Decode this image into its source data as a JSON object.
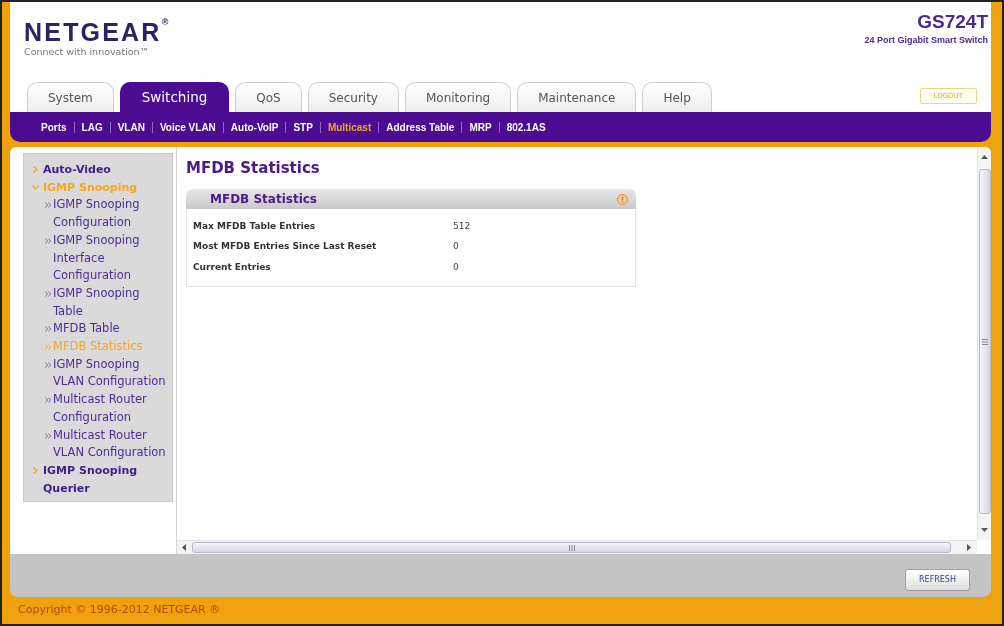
{
  "header": {
    "logo": "NETGEAR$^{®}$",
    "tagline": "Connect with innovation™",
    "model": "GS724T",
    "model_description": "24 Port Gigabit Smart Switch"
  },
  "tabs": [
    {
      "label": "System",
      "selected": false
    },
    {
      "label": "Switching",
      "selected": true
    },
    {
      "label": "QoS",
      "selected": false
    },
    {
      "label": "Security",
      "selected": false
    },
    {
      "label": "Monitoring",
      "selected": false
    },
    {
      "label": "Maintenance",
      "selected": false
    },
    {
      "label": "Help",
      "selected": false
    }
  ],
  "logout_button": "LOGOUT",
  "subnav": [
    {
      "label": "Ports",
      "selected": false
    },
    {
      "label": "LAG",
      "selected": false
    },
    {
      "label": "VLAN",
      "selected": false
    },
    {
      "label": "Voice VLAN",
      "selected": false
    },
    {
      "label": "Auto-VoIP",
      "selected": false
    },
    {
      "label": "STP",
      "selected": false
    },
    {
      "label": "Multicast",
      "selected": true
    },
    {
      "label": "Address Table",
      "selected": false
    },
    {
      "label": "MRP",
      "selected": false
    },
    {
      "label": "802.1AS",
      "selected": false
    }
  ],
  "sidebar": {
    "items": [
      {
        "label": "Auto-Video",
        "selected": false,
        "expanded": false
      },
      {
        "label": "IGMP Snooping",
        "selected": true,
        "expanded": true,
        "children": [
          {
            "label": "IGMP Snooping Configuration",
            "selected": false
          },
          {
            "label": "IGMP Snooping Interface Configuration",
            "selected": false
          },
          {
            "label": "IGMP Snooping Table",
            "selected": false
          },
          {
            "label": "MFDB Table",
            "selected": false
          },
          {
            "label": "MFDB Statistics",
            "selected": true
          },
          {
            "label": "IGMP Snooping VLAN Configuration",
            "selected": false
          },
          {
            "label": "Multicast Router Configuration",
            "selected": false
          },
          {
            "label": "Multicast Router VLAN Configuration",
            "selected": false
          }
        ]
      },
      {
        "label": "IGMP Snooping Querier",
        "selected": false,
        "expanded": false
      }
    ]
  },
  "page_title": "MFDB Statistics",
  "panel": {
    "title": "MFDB Statistics",
    "rows": [
      {
        "label": "Max MFDB Table Entries",
        "value": "512"
      },
      {
        "label": "Most MFDB Entries Since Last Reset",
        "value": "0"
      },
      {
        "label": "Current Entries",
        "value": "0"
      }
    ]
  },
  "refresh_button": "REFRESH",
  "footer": "Copyright © 1996-2012 NETGEAR ®"
}
